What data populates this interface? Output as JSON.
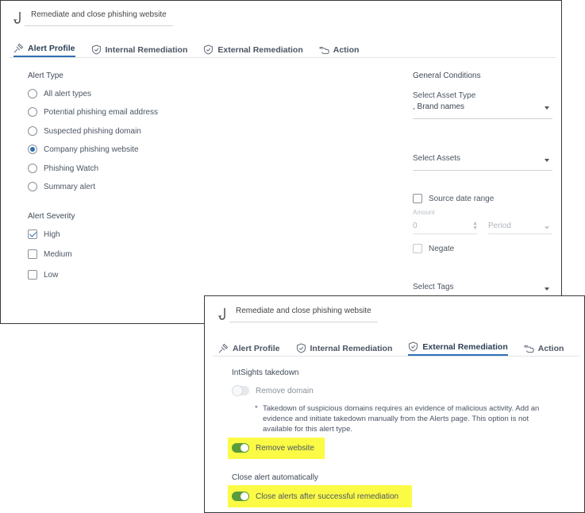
{
  "colors": {
    "accent": "#2f6fb3",
    "toggle_on": "#5a9b3c",
    "highlight": "#fbfb46"
  },
  "panel1": {
    "rule_icon": "hook-icon",
    "rule_name": "Remediate and close phishing website",
    "tabs": [
      {
        "label": "Alert Profile",
        "icon": "pin-icon",
        "active": true
      },
      {
        "label": "Internal Remediation",
        "icon": "shield-check-icon",
        "active": false
      },
      {
        "label": "External Remediation",
        "icon": "shield-check-icon",
        "active": false
      },
      {
        "label": "Action",
        "icon": "hand-pointer-icon",
        "active": false
      }
    ],
    "alert_type": {
      "label": "Alert Type",
      "options": [
        {
          "label": "All alert types",
          "checked": false
        },
        {
          "label": "Potential phishing email address",
          "checked": false
        },
        {
          "label": "Suspected phishing domain",
          "checked": false
        },
        {
          "label": "Company phishing website",
          "checked": true
        },
        {
          "label": "Phishing Watch",
          "checked": false
        },
        {
          "label": "Summary alert",
          "checked": false
        }
      ]
    },
    "alert_severity": {
      "label": "Alert Severity",
      "options": [
        {
          "label": "High",
          "checked": true
        },
        {
          "label": "Medium",
          "checked": false
        },
        {
          "label": "Low",
          "checked": false
        }
      ]
    },
    "general_conditions": {
      "label": "General Conditions",
      "asset_type": {
        "label": "Select Asset Type",
        "value": ", Brand names"
      },
      "assets": {
        "label": "Select Assets"
      },
      "source_date_range": {
        "label": "Source date range",
        "checked": false
      },
      "amount_label": "Amount",
      "amount_value": "0",
      "period_placeholder": "Period",
      "negate": {
        "label": "Negate",
        "checked": false
      },
      "tags": {
        "label": "Select Tags"
      }
    }
  },
  "panel2": {
    "rule_icon": "hook-icon",
    "rule_name": "Remediate and close phishing website",
    "tabs": [
      {
        "label": "Alert Profile",
        "icon": "pin-icon",
        "active": false
      },
      {
        "label": "Internal Remediation",
        "icon": "shield-check-icon",
        "active": false
      },
      {
        "label": "External Remediation",
        "icon": "shield-check-icon",
        "active": true
      },
      {
        "label": "Action",
        "icon": "hand-pointer-icon",
        "active": false
      }
    ],
    "takedown_label": "IntSights takedown",
    "remove_domain": {
      "label": "Remove domain",
      "on": false
    },
    "note_star": "*",
    "note": "Takedown of suspicious domains requires an evidence of malicious activity. Add an evidence and initiate takedown manually from the Alerts page. This option is not available for this alert type.",
    "remove_website": {
      "label": "Remove website",
      "on": true
    },
    "close_label": "Close alert automatically",
    "close_after": {
      "label": "Close alerts after successful remediation",
      "on": true
    }
  }
}
